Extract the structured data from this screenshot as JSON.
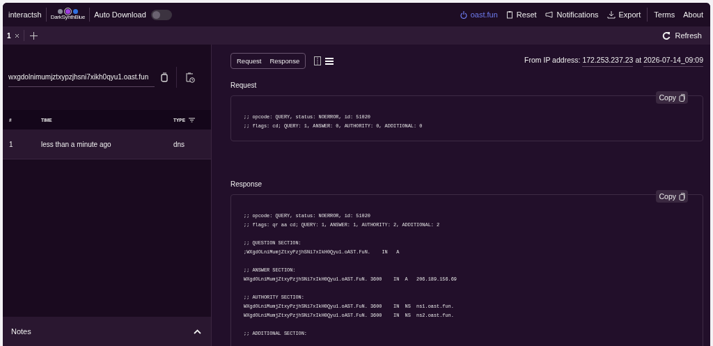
{
  "header": {
    "app_name": "interactsh",
    "theme": {
      "name": "DarkSynthBlue",
      "dots": [
        {
          "color": "#8a8a9a",
          "selected": false
        },
        {
          "color": "#a040e0",
          "selected": true
        },
        {
          "color": "#3070e0",
          "selected": false
        }
      ]
    },
    "auto_download": {
      "label": "Auto Download",
      "on": false
    },
    "links": [
      {
        "kind": "server",
        "label": "oast.fun"
      },
      {
        "kind": "reset",
        "label": "Reset"
      },
      {
        "kind": "notifications",
        "label": "Notifications"
      },
      {
        "kind": "export",
        "label": "Export"
      },
      {
        "kind": "terms",
        "label": "Terms"
      },
      {
        "kind": "about",
        "label": "About"
      }
    ]
  },
  "tabs": [
    {
      "label": "1",
      "selected": true
    }
  ],
  "refresh": "Refresh",
  "sidebar": {
    "domain": "wxgdolnimumjztxypzjhsni7xikh0qyu1.oast.fun",
    "table": {
      "columns": [
        "#",
        "TIME",
        "TYPE"
      ],
      "rows": [
        {
          "cells": [
            "1",
            "less than a minute ago",
            "dns"
          ],
          "selected": true
        }
      ]
    },
    "notes": {
      "label": "Notes",
      "expanded": false
    }
  },
  "detail": {
    "view_toggle": [
      {
        "label": "Request"
      },
      {
        "label": "Response"
      }
    ],
    "layouts": [
      {
        "kind": "side-by-side",
        "selected": false
      },
      {
        "kind": "stacked",
        "selected": true
      }
    ],
    "from_prefix": "From IP address:",
    "ip": "172.253.237.23",
    "at": "at",
    "time": "2026-07-14_09:09",
    "sections": [
      {
        "title": "Request",
        "copy": "Copy",
        "blocks": [
          [
            ";; opcode: QUERY, status: NOERROR, id: 51020",
            ";; flags: cd; QUERY: 1, ANSWER: 0, AUTHORITY: 0, ADDITIONAL: 0"
          ]
        ]
      },
      {
        "title": "Response",
        "copy": "Copy",
        "blocks": [
          [
            ";; opcode: QUERY, status: NOERROR, id: 51020",
            ";; flags: qr aa cd; QUERY: 1, ANSWER: 1, AUTHORITY: 2, ADDITIONAL: 2"
          ],
          [
            ";; QUESTION SECTION:",
            ";WXgdOLniMumjZtxyPzjhSNi7xIkH0Qyu1.oAST.FuN.    IN   A"
          ],
          [
            ";; ANSWER SECTION:",
            "WXgdOLniMumjZtxyPzjhSNi7xIkH0Qyu1.oAST.FuN. 3600    IN  A   206.189.156.69"
          ],
          [
            ";; AUTHORITY SECTION:",
            "WXgdOLniMumjZtxyPzjhSNi7xIkH0Qyu1.oAST.FuN. 3600    IN  NS  ns1.oast.fun.",
            "WXgdOLniMumjZtxyPzjhSNi7xIkH0Qyu1.oAST.FuN. 3600    IN  NS  ns2.oast.fun."
          ],
          [
            ";; ADDITIONAL SECTION:"
          ]
        ]
      }
    ]
  }
}
